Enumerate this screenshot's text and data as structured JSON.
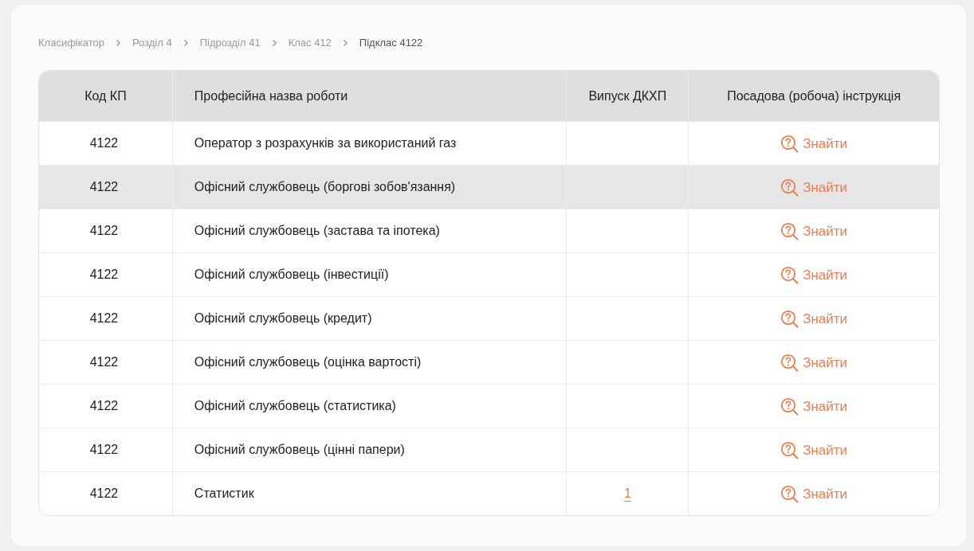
{
  "breadcrumbs": [
    {
      "label": "Класифікатор",
      "current": false
    },
    {
      "label": "Розділ 4",
      "current": false
    },
    {
      "label": "Підрозділ 41",
      "current": false
    },
    {
      "label": "Клас 412",
      "current": false
    },
    {
      "label": "Підклас 4122",
      "current": true
    }
  ],
  "table": {
    "columns": [
      "Код КП",
      "Професійна назва роботи",
      "Випуск ДКХП",
      "Посадова (робоча) інструкція"
    ],
    "rows": [
      {
        "code": "4122",
        "name": "Оператор з розрахунків за використаний газ",
        "issue": "",
        "action": "Знайти",
        "selected": false
      },
      {
        "code": "4122",
        "name": "Офісний службовець (боргові зобов'язання)",
        "issue": "",
        "action": "Знайти",
        "selected": true
      },
      {
        "code": "4122",
        "name": "Офісний службовець (застава та іпотека)",
        "issue": "",
        "action": "Знайти",
        "selected": false
      },
      {
        "code": "4122",
        "name": "Офісний службовець (інвестиції)",
        "issue": "",
        "action": "Знайти",
        "selected": false
      },
      {
        "code": "4122",
        "name": "Офісний службовець (кредит)",
        "issue": "",
        "action": "Знайти",
        "selected": false
      },
      {
        "code": "4122",
        "name": "Офісний службовець (оцінка вартості)",
        "issue": "",
        "action": "Знайти",
        "selected": false
      },
      {
        "code": "4122",
        "name": "Офісний службовець (статистика)",
        "issue": "",
        "action": "Знайти",
        "selected": false
      },
      {
        "code": "4122",
        "name": "Офісний службовець (цінні папери)",
        "issue": "",
        "action": "Знайти",
        "selected": false
      },
      {
        "code": "4122",
        "name": "Статистик",
        "issue": "1",
        "action": "Знайти",
        "selected": false
      }
    ]
  }
}
